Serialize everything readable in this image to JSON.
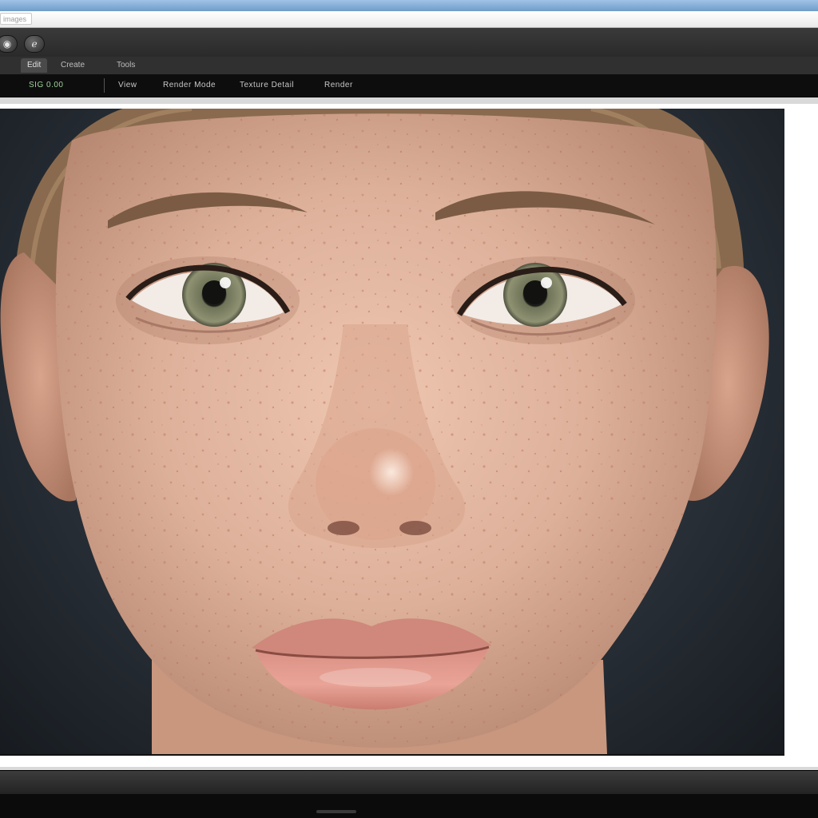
{
  "address": {
    "text": "images"
  },
  "toolbar": {
    "buttons": [
      {
        "name": "record-icon",
        "glyph": "◉"
      },
      {
        "name": "brush-icon",
        "glyph": "ℯ"
      }
    ]
  },
  "tabs": [
    {
      "label": "Edit",
      "active": true
    },
    {
      "label": "Create",
      "active": false
    },
    {
      "label": "Tools",
      "active": false
    }
  ],
  "options": {
    "items": [
      {
        "label": "SIG 0.00",
        "color": "green"
      },
      {
        "label": "View",
        "color": "normal"
      },
      {
        "label": "Render Mode",
        "color": "normal"
      },
      {
        "label": "Texture Detail",
        "color": "normal"
      },
      {
        "label": "Render",
        "color": "normal"
      }
    ]
  },
  "status": {
    "text": ""
  },
  "colors": {
    "accent_green": "#9fd29a",
    "toolbar": "#2a2a2a",
    "canvas_bg": "#2a3139",
    "skin": "#e2b7a2"
  }
}
